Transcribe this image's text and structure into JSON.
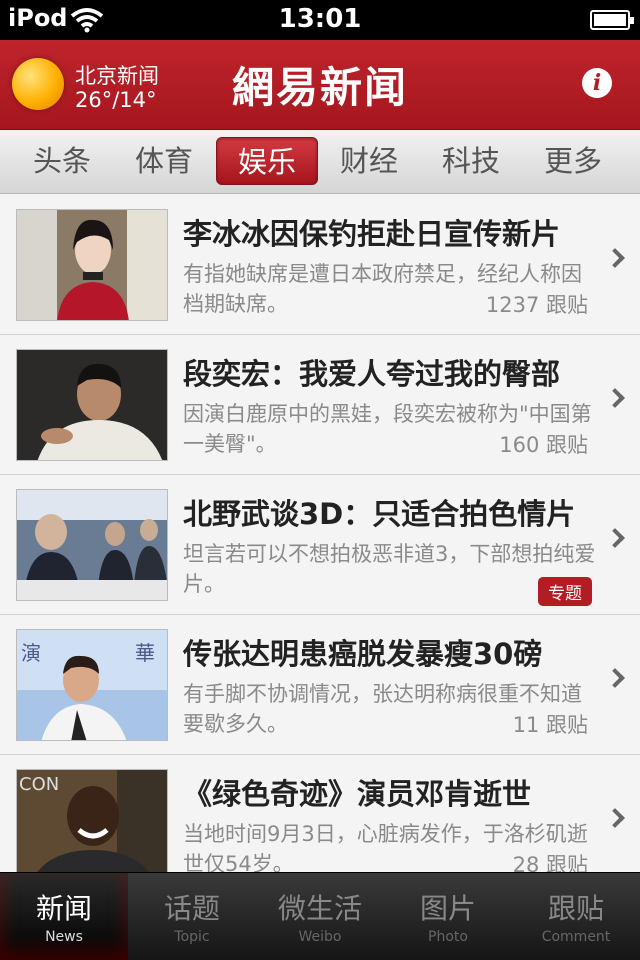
{
  "status_bar": {
    "carrier": "iPod",
    "time": "13:01"
  },
  "header": {
    "weather_city": "北京新闻",
    "weather_temp": "26°/14°",
    "app_title": "網易新闻",
    "info_label": "i"
  },
  "categories": [
    {
      "label": "头条",
      "active": false
    },
    {
      "label": "体育",
      "active": false
    },
    {
      "label": "娱乐",
      "active": true
    },
    {
      "label": "财经",
      "active": false
    },
    {
      "label": "科技",
      "active": false
    },
    {
      "label": "更多",
      "active": false
    }
  ],
  "news": [
    {
      "title": "李冰冰因保钓拒赴日宣传新片",
      "desc": "有指她缺席是遭日本政府禁足，经纪人称因档期缺席。",
      "count": "1237 跟贴"
    },
    {
      "title": "段奕宏：我爱人夸过我的臀部",
      "desc": "因演白鹿原中的黑娃，段奕宏被称为\"中国第一美臀\"。",
      "count": "160 跟贴"
    },
    {
      "title": "北野武谈3D：只适合拍色情片",
      "desc": "坦言若可以不想拍极恶非道3，下部想拍纯爱片。",
      "tag": "专题"
    },
    {
      "title": "传张达明患癌脱发暴瘦30磅",
      "desc": "有手脚不协调情况，张达明称病很重不知道要歇多久。",
      "count": "11 跟贴"
    },
    {
      "title": "《绿色奇迹》演员邓肯逝世",
      "desc": "当地时间9月3日，心脏病发作，于洛杉矶逝世仅54岁。",
      "count": "28 跟贴"
    }
  ],
  "tabs": [
    {
      "zh": "新闻",
      "en": "News",
      "active": true
    },
    {
      "zh": "话题",
      "en": "Topic",
      "active": false
    },
    {
      "zh": "微生活",
      "en": "Weibo",
      "active": false
    },
    {
      "zh": "图片",
      "en": "Photo",
      "active": false
    },
    {
      "zh": "跟贴",
      "en": "Comment",
      "active": false
    }
  ]
}
